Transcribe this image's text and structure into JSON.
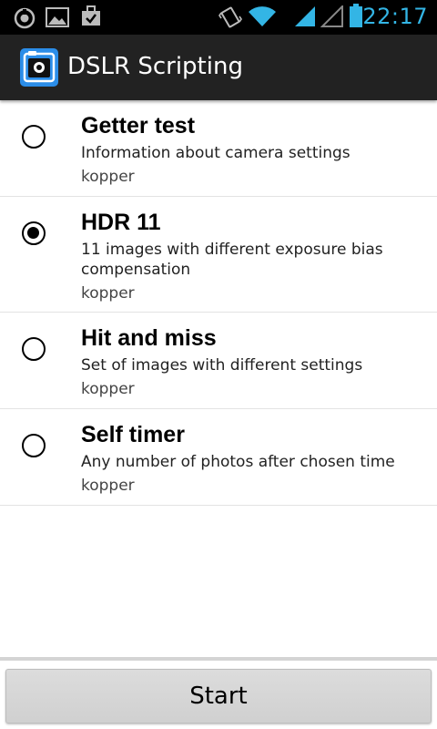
{
  "status_bar": {
    "time": "22:17",
    "icons": [
      "headset-notification-icon",
      "gallery-notification-icon",
      "task-notification-icon",
      "vibrate-icon",
      "wifi-icon",
      "signal-icon",
      "no-signal-icon",
      "battery-icon"
    ],
    "accent_color": "#33b5e5"
  },
  "action_bar": {
    "title": "DSLR Scripting",
    "app_icon": "camera-app-icon",
    "icon_color": "#2b8de8"
  },
  "scripts": [
    {
      "title": "Getter test",
      "description": "Information about camera settings",
      "author": "kopper",
      "selected": false
    },
    {
      "title": "HDR 11",
      "description": "11 images with different exposure bias compensation",
      "author": "kopper",
      "selected": true
    },
    {
      "title": "Hit and miss",
      "description": "Set of images with different settings",
      "author": "kopper",
      "selected": false
    },
    {
      "title": "Self timer",
      "description": "Any number of photos after chosen time",
      "author": "kopper",
      "selected": false
    }
  ],
  "start_button": {
    "label": "Start"
  }
}
